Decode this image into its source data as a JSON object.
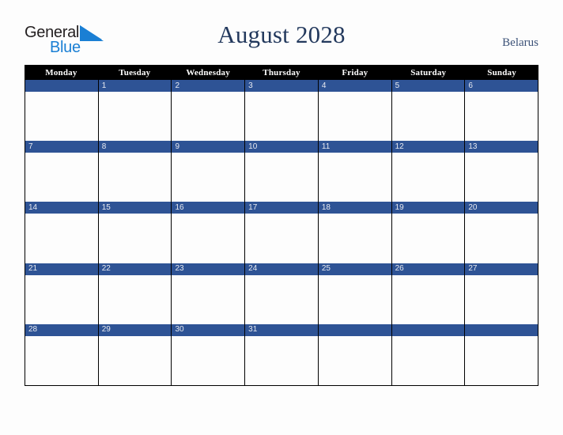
{
  "logo": {
    "text_primary": "General",
    "text_secondary": "Blue",
    "triangle_color": "#1a7fd4",
    "primary_color": "#231f20",
    "secondary_color": "#1a7fd4"
  },
  "header": {
    "title": "August 2028",
    "country": "Belarus",
    "title_color": "#23395d",
    "country_color": "#3c5278"
  },
  "calendar": {
    "weekday_header_bg": "#000000",
    "weekday_header_color": "#ffffff",
    "day_band_color": "#2e5395",
    "day_number_color": "#e8eaf0",
    "cell_bg": "#fdfdfd",
    "border_color": "#000000",
    "weekdays": [
      "Monday",
      "Tuesday",
      "Wednesday",
      "Thursday",
      "Friday",
      "Saturday",
      "Sunday"
    ],
    "weeks": [
      [
        {
          "day": ""
        },
        {
          "day": "1"
        },
        {
          "day": "2"
        },
        {
          "day": "3"
        },
        {
          "day": "4"
        },
        {
          "day": "5"
        },
        {
          "day": "6"
        }
      ],
      [
        {
          "day": "7"
        },
        {
          "day": "8"
        },
        {
          "day": "9"
        },
        {
          "day": "10"
        },
        {
          "day": "11"
        },
        {
          "day": "12"
        },
        {
          "day": "13"
        }
      ],
      [
        {
          "day": "14"
        },
        {
          "day": "15"
        },
        {
          "day": "16"
        },
        {
          "day": "17"
        },
        {
          "day": "18"
        },
        {
          "day": "19"
        },
        {
          "day": "20"
        }
      ],
      [
        {
          "day": "21"
        },
        {
          "day": "22"
        },
        {
          "day": "23"
        },
        {
          "day": "24"
        },
        {
          "day": "25"
        },
        {
          "day": "26"
        },
        {
          "day": "27"
        }
      ],
      [
        {
          "day": "28"
        },
        {
          "day": "29"
        },
        {
          "day": "30"
        },
        {
          "day": "31"
        },
        {
          "day": ""
        },
        {
          "day": ""
        },
        {
          "day": ""
        }
      ]
    ]
  }
}
